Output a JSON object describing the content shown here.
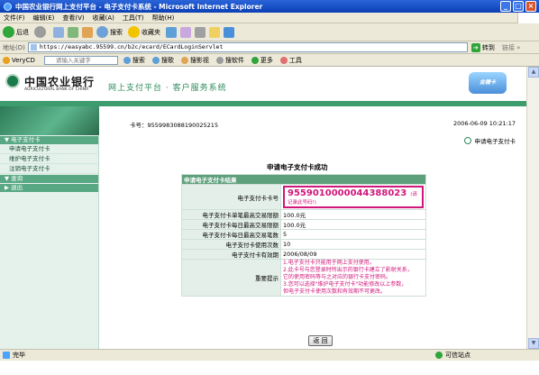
{
  "window": {
    "title": "中国农业银行网上支付平台 - 电子支付卡系统 - Microsoft Internet Explorer",
    "minimize": "_",
    "maximize": "□",
    "close": "×"
  },
  "menu": [
    "文件(F)",
    "编辑(E)",
    "查看(V)",
    "收藏(A)",
    "工具(T)",
    "帮助(H)"
  ],
  "toolbar": {
    "back": "后退",
    "search": "搜索",
    "favorites": "收藏夹"
  },
  "addressbar": {
    "label": "地址(D)",
    "url": "https://easyabc.95599.cn/b2c/ecard/ECardLoginServlet",
    "go": "转到",
    "links": "链接 »"
  },
  "searchbar": {
    "brand": "VeryCD",
    "placeholder": "请输入关键字",
    "items": [
      "搜索",
      "搜歌",
      "搜影视",
      "搜软件",
      "更多",
      "工具"
    ]
  },
  "header": {
    "bank_name": "中国农业银行",
    "bank_en": "AGRICULTURAL BANK OF CHINA",
    "title": "网上支付平台 · 客户服务系统",
    "logo_text": "金穗卡"
  },
  "sidebar": {
    "sections": [
      {
        "label": "▼ 电子支付卡",
        "items": [
          "申请电子支付卡",
          "维护电子支付卡",
          "注销电子支付卡"
        ]
      },
      {
        "label": "▼ 查询",
        "items": []
      },
      {
        "label": "▶ 退出",
        "items": []
      }
    ]
  },
  "main": {
    "card_line": "卡号：9559983088190025215",
    "datetime": "2006-06-09 10:21:17",
    "apply_link": "申请电子支付卡",
    "success_title": "申请电子支付卡成功",
    "table_header": "申请电子支付卡结果",
    "rows": [
      {
        "label": "电子支付卡卡号",
        "value": "9559010000044388023",
        "note": "(请记录此号码!)"
      },
      {
        "label": "电子支付卡单笔最高交易限额",
        "value": "100.0元"
      },
      {
        "label": "电子支付卡每日最高交易限额",
        "value": "100.0元"
      },
      {
        "label": "电子支付卡每日最高交易笔数",
        "value": "5"
      },
      {
        "label": "电子支付卡使用次数",
        "value": "10"
      },
      {
        "label": "电子支付卡有效期",
        "value": "2006/08/09"
      }
    ],
    "notice_label": "重要提示",
    "notices": [
      "1.电子支付卡只能用于网上支付使用。",
      "2.此卡号与您登录时所出示的银行卡建立了影射关系，",
      "  它的使用密码等与之对应的银行卡支付密码。",
      "3.您可以选择\"维护电子支付卡\"功能修改以上参数，",
      "  但电子支付卡使用次数和有效期不可更改。"
    ],
    "back_button": "返 回"
  },
  "status": {
    "text": "完毕",
    "zone": "可信站点"
  }
}
